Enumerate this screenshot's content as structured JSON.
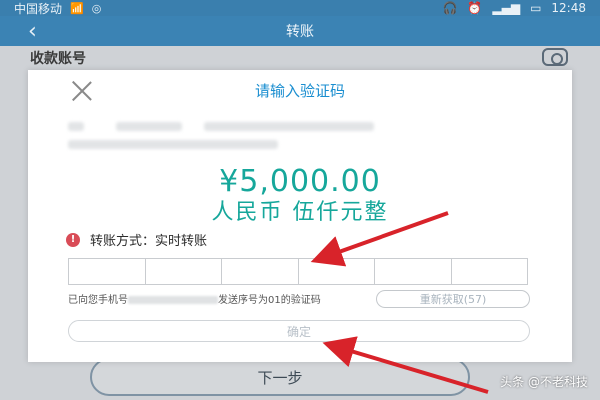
{
  "status_bar": {
    "carrier": "中国移动",
    "time": "12:48",
    "icons": [
      "wifi-icon",
      "messenger-icon",
      "headset-icon",
      "alarm-icon",
      "signal-icon",
      "battery-icon"
    ]
  },
  "nav": {
    "title": "转账",
    "back_icon": "chevron-left-icon"
  },
  "page": {
    "payee_label": "收款账号",
    "next_button": "下一步"
  },
  "dialog": {
    "title": "请输入验证码",
    "amount": "¥5,000.00",
    "amount_chinese": "人民币 伍仟元整",
    "method_label": "转账方式：",
    "method_value": "实时转账",
    "hint_prefix": "已向您手机号",
    "hint_suffix": "发送序号为01的验证码",
    "resend_button": "重新获取(57)",
    "confirm_button": "确定"
  },
  "watermark": "头条 @不老科技",
  "colors": {
    "accent_blue": "#1a8ed0",
    "amount_green": "#16a79b",
    "arrow_red": "#d8232a",
    "status_bar": "#3a7fae"
  }
}
